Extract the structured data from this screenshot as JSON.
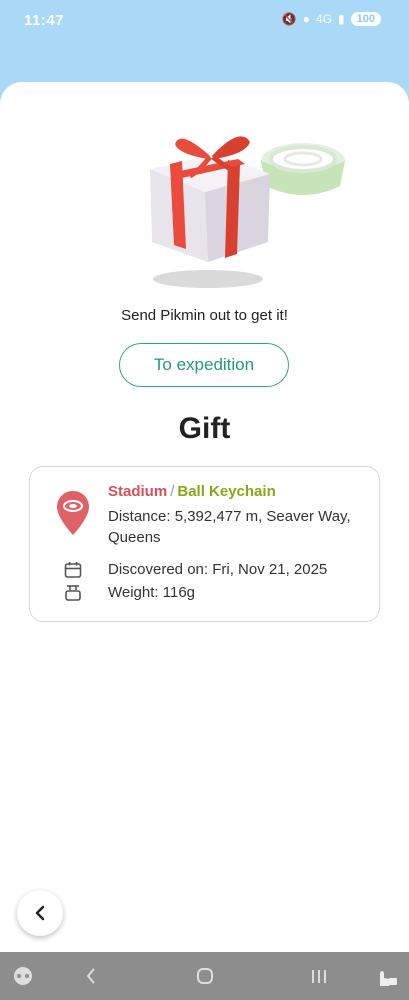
{
  "status": {
    "time": "11:47",
    "battery": "100",
    "signal_label": "4G"
  },
  "hero": {
    "prompt": "Send Pikmin out to get it!",
    "expedition_button": "To expedition"
  },
  "title": "Gift",
  "card": {
    "type": "Stadium",
    "separator": "/",
    "item": "Ball Keychain",
    "distance": "Distance: 5,392,477 m, Seaver Way, Queens",
    "discovered": "Discovered on: Fri, Nov 21, 2025",
    "weight": "Weight:  116g"
  },
  "colors": {
    "sky": "#a9d9f6",
    "accent_green": "#1f9b7e",
    "type_red": "#d8505a",
    "item_olive": "#8aa51a"
  },
  "icons": {
    "pin": "stadium-pin-icon",
    "calendar": "calendar-icon",
    "scale": "scale-icon",
    "back": "chevron-left-icon"
  }
}
